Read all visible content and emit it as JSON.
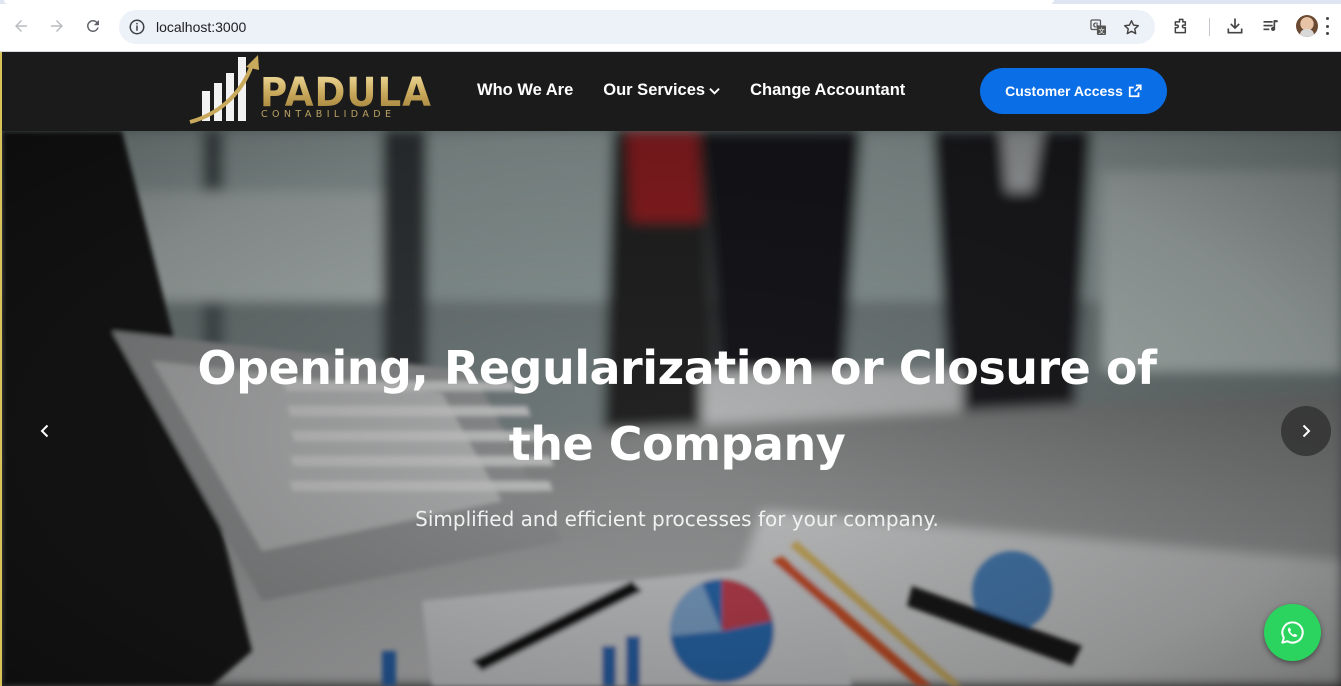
{
  "browser": {
    "url": "localhost:3000",
    "icons": [
      "back-icon",
      "forward-icon",
      "reload-icon",
      "site-info-icon",
      "translate-icon",
      "bookmark-star-icon",
      "extensions-icon",
      "download-icon",
      "media-queue-icon",
      "profile-avatar",
      "menu-dots-icon"
    ]
  },
  "header": {
    "logo": {
      "word": "PADULA",
      "sub": "CONTABILIDADE"
    },
    "nav": {
      "who_we_are": "Who We Are",
      "our_services": "Our Services",
      "change_accountant": "Change Accountant"
    },
    "cta": {
      "label": "Customer Access",
      "icon": "external-link-icon"
    }
  },
  "hero": {
    "title": "Opening, Regularization or Closure of the Company",
    "subtitle": "Simplified and efficient processes for your company.",
    "prev_icon": "chevron-left-icon",
    "next_icon": "chevron-right-icon"
  },
  "floating": {
    "icon": "whatsapp-icon"
  },
  "colors": {
    "header_bg": "#1b1b1b",
    "accent_gold": "#c9a95c",
    "cta_blue": "#0a6ee6",
    "whatsapp_green": "#2bd45e"
  }
}
